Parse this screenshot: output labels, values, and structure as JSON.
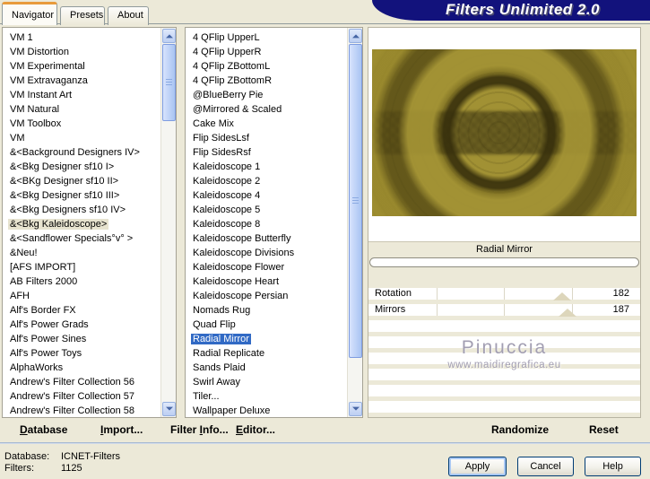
{
  "window": {
    "title": "Filters Unlimited 2.0",
    "tabs": [
      "Navigator",
      "Presets",
      "About"
    ],
    "active_tab": "Navigator"
  },
  "category_list": {
    "selected": "&<Bkg Kaleidoscope>",
    "items": [
      "VM 1",
      "VM Distortion",
      "VM Experimental",
      "VM Extravaganza",
      "VM Instant Art",
      "VM Natural",
      "VM Toolbox",
      "VM",
      "&<Background Designers IV>",
      "&<Bkg Designer sf10 I>",
      "&<BKg Designer sf10 II>",
      "&<Bkg Designer sf10 III>",
      "&<Bkg Designers sf10 IV>",
      "&<Bkg Kaleidoscope>",
      "&<Sandflower Specials°v° >",
      "&Neu!",
      "[AFS IMPORT]",
      "AB Filters 2000",
      "AFH",
      "Alf's Border FX",
      "Alf's Power Grads",
      "Alf's Power Sines",
      "Alf's Power Toys",
      "AlphaWorks",
      "Andrew's Filter Collection 56",
      "Andrew's Filter Collection 57",
      "Andrew's Filter Collection 58"
    ]
  },
  "filter_list": {
    "selected": "Radial Mirror",
    "items": [
      "4 QFlip UpperL",
      "4 QFlip UpperR",
      "4 QFlip ZBottomL",
      "4 QFlip ZBottomR",
      "@BlueBerry Pie",
      "@Mirrored & Scaled",
      "Cake Mix",
      "Flip SidesLsf",
      "Flip SidesRsf",
      "Kaleidoscope 1",
      "Kaleidoscope 2",
      "Kaleidoscope 4",
      "Kaleidoscope 5",
      "Kaleidoscope 8",
      "Kaleidoscope Butterfly",
      "Kaleidoscope Divisions",
      "Kaleidoscope Flower",
      "Kaleidoscope Heart",
      "Kaleidoscope Persian",
      "Nomads Rug",
      "Quad Flip",
      "Radial Mirror",
      "Radial Replicate",
      "Sands Plaid",
      "Swirl Away",
      "Tiler...",
      "Wallpaper Deluxe"
    ]
  },
  "preview": {
    "header": "Radial Mirror"
  },
  "controls": {
    "sliders": [
      {
        "label": "Rotation",
        "value": 182
      },
      {
        "label": "Mirrors",
        "value": 187
      }
    ],
    "slider_range_max": 255
  },
  "watermark": {
    "line1": "Pinuccia",
    "line2": "www.maidiregrafica.eu"
  },
  "command_bar": {
    "database": {
      "pre": "",
      "key": "D",
      "post": "atabase"
    },
    "import": {
      "pre": "",
      "key": "I",
      "post": "mport..."
    },
    "filter_info": {
      "pre": "Filter ",
      "key": "I",
      "post": "nfo..."
    },
    "editor": {
      "pre": "",
      "key": "E",
      "post": "ditor..."
    },
    "randomize": "Randomize",
    "reset": "Reset"
  },
  "status": {
    "database_label": "Database:",
    "database_value": "ICNET-Filters",
    "filters_label": "Filters:",
    "filters_value": "1125"
  },
  "dialog_buttons": {
    "apply": "Apply",
    "cancel": "Cancel",
    "help": "Help"
  },
  "colors": {
    "dialog_background": "#ece9d8",
    "banner_navy": "#12127c",
    "selection_blue": "#316ac5",
    "inactive_selection": "#e7e3cf",
    "tab_accent_orange": "#e89b3c",
    "preview_gold": "#9d8d30"
  }
}
